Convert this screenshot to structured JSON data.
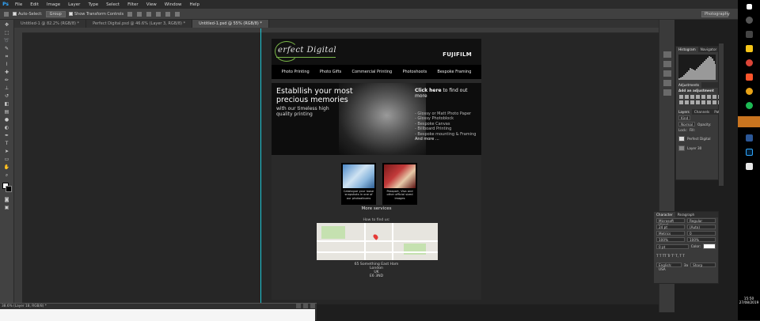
{
  "app": {
    "logo": "Ps",
    "menu": [
      "File",
      "Edit",
      "Image",
      "Layer",
      "Type",
      "Select",
      "Filter",
      "View",
      "Window",
      "Help"
    ]
  },
  "options": {
    "auto_select_label": "Auto-Select:",
    "auto_select_value": "Group",
    "transform_label": "Show Transform Controls",
    "workspace": "Photography"
  },
  "tabs": [
    {
      "label": "Untitled-1 @ 82.2% (RGB/8) *",
      "active": false
    },
    {
      "label": "Perfect Digital.psd @ 46.6% (Layer 3, RGB/8) *",
      "active": false
    },
    {
      "label": "Untitled-1.psd @ 55% (RGB/8) *",
      "active": true
    }
  ],
  "doc": {
    "brand": "erfect Digital",
    "partner": "FUJIFILM",
    "nav": [
      "Photo Printing",
      "Photo Gifts",
      "Commercial Printing",
      "Photoshoots",
      "Bespoke Framing"
    ],
    "hero": {
      "headline": "Establlish your most precious memories",
      "sub": "with our timeless high quality printing",
      "cta_bold": "Click here",
      "cta_rest": " to find out more",
      "list": [
        "- Glossy or Matt Photo Paper",
        "- Glossy Photoblock",
        "- Bespoke Canvas",
        "- Billboard Printing",
        "- Bespoke mounting & Framing",
        "And more ..."
      ]
    },
    "cards": [
      {
        "caption": "Catalogue your loose snapshots in one of our photoalbums"
      },
      {
        "caption": "Passport, Visa and other official sized images"
      }
    ],
    "more_services": "More services",
    "find_us": "How to find us:",
    "address": [
      "65 Something East Ham",
      "London",
      "UK",
      "E6 3ND"
    ]
  },
  "panels": {
    "histogram_tabs": [
      "Histogram",
      "Navigator"
    ],
    "adjustments_tab": "Adjustments",
    "add_adjustment": "Add an adjustment",
    "layers_tabs": [
      "Layers",
      "Channels",
      "Paths"
    ],
    "kind": "Kind",
    "blend": "Normal",
    "opacity_label": "Opacity:",
    "lock_label": "Lock:",
    "fill_label": "Fill:",
    "layers": [
      "Perfect Digital",
      "Layer 30"
    ],
    "character_tabs": [
      "Character",
      "Paragraph"
    ],
    "font_family": "Microsoft Himal...",
    "font_style": "Regular",
    "font_size": "24 pt",
    "leading": "(Auto)",
    "kerning": "Metrics",
    "tracking": "0",
    "scale_v": "100%",
    "scale_h": "100%",
    "baseline": "0 pt",
    "color_label": "Color:",
    "language": "English: USA",
    "aa": "Sharp",
    "aa_prefix": "3a"
  },
  "bottom_doc": {
    "title": "38.6% (Layer 18, RGB/8) *"
  },
  "taskbar": {
    "time": "15:50",
    "date": "27/08/2019"
  },
  "colors": {
    "accent_green": "#7ab648",
    "guide_cyan": "#1ec8d8"
  }
}
